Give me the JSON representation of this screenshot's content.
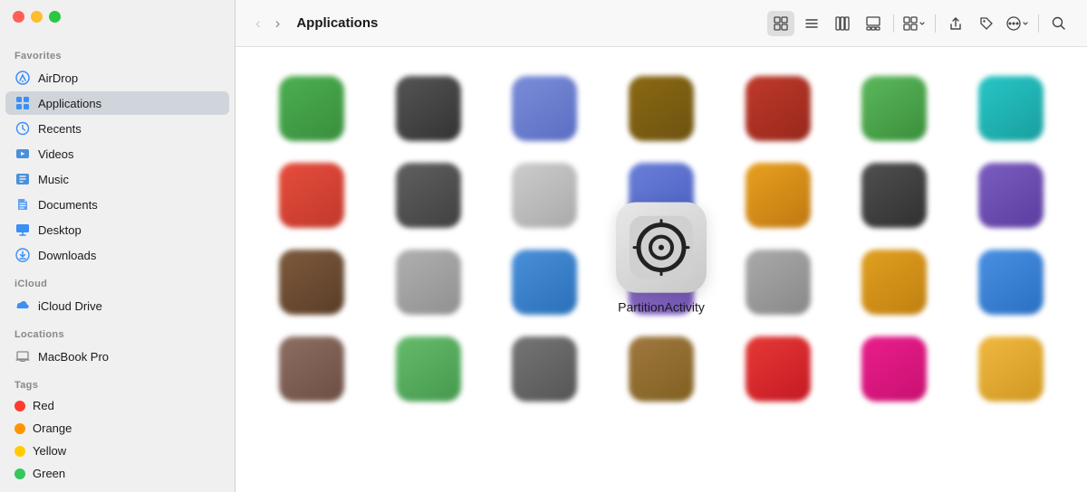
{
  "window": {
    "title": "Applications"
  },
  "traffic_lights": {
    "red_label": "close",
    "yellow_label": "minimize",
    "green_label": "maximize"
  },
  "toolbar": {
    "back_button": "‹",
    "forward_button": "›",
    "title": "Applications",
    "view_icons": [
      "grid-icon",
      "list-icon",
      "columns-icon",
      "gallery-icon",
      "groupby-icon",
      "share-icon",
      "tag-icon",
      "action-icon",
      "search-icon"
    ]
  },
  "sidebar": {
    "sections": [
      {
        "id": "favorites",
        "label": "Favorites",
        "items": [
          {
            "id": "airdrop",
            "label": "AirDrop",
            "icon_color": "#3b8ff5",
            "icon_type": "airdrop"
          },
          {
            "id": "applications",
            "label": "Applications",
            "icon_color": "#3b8ff5",
            "icon_type": "apps",
            "active": true
          },
          {
            "id": "recents",
            "label": "Recents",
            "icon_color": "#3b8ff5",
            "icon_type": "clock"
          },
          {
            "id": "videos",
            "label": "Videos",
            "icon_color": "#4a90d9",
            "icon_type": "folder"
          },
          {
            "id": "music",
            "label": "Music",
            "icon_color": "#4a90d9",
            "icon_type": "folder"
          },
          {
            "id": "documents",
            "label": "Documents",
            "icon_color": "#3b8ff5",
            "icon_type": "doc"
          },
          {
            "id": "desktop",
            "label": "Desktop",
            "icon_color": "#3b8ff5",
            "icon_type": "desktop"
          },
          {
            "id": "downloads",
            "label": "Downloads",
            "icon_color": "#3b8ff5",
            "icon_type": "download"
          }
        ]
      },
      {
        "id": "icloud",
        "label": "iCloud",
        "items": [
          {
            "id": "icloud-drive",
            "label": "iCloud Drive",
            "icon_color": "#3b8ff5",
            "icon_type": "cloud"
          }
        ]
      },
      {
        "id": "locations",
        "label": "Locations",
        "items": [
          {
            "id": "macbook-pro",
            "label": "MacBook Pro",
            "icon_color": "#888",
            "icon_type": "laptop"
          }
        ]
      },
      {
        "id": "tags",
        "label": "Tags",
        "items": [
          {
            "id": "tag-red",
            "label": "Red",
            "dot_color": "#ff3b30"
          },
          {
            "id": "tag-orange",
            "label": "Orange",
            "dot_color": "#ff9500"
          },
          {
            "id": "tag-yellow",
            "label": "Yellow",
            "dot_color": "#ffcc00"
          },
          {
            "id": "tag-green",
            "label": "Green",
            "dot_color": "#34c759"
          }
        ]
      }
    ]
  },
  "focused_app": {
    "name": "PartitionActivity",
    "icon_bg": "#e0e0e0"
  },
  "app_grid_rows": [
    [
      {
        "color": "#4caf50",
        "color2": "#388e3c"
      },
      {
        "color": "#555",
        "color2": "#333"
      },
      {
        "color": "#7b8dd8",
        "color2": "#5a6dc2"
      },
      {
        "color": "#8B6914",
        "color2": "#6d5310"
      },
      {
        "color": "#c0392b",
        "color2": "#96281b"
      },
      {
        "color": "#5cb85c",
        "color2": "#3a8f3a"
      },
      {
        "color": "#26c6c6",
        "color2": "#1a9e9e"
      }
    ],
    [
      {
        "color": "#e74c3c",
        "color2": "#c0392b"
      },
      {
        "color": "#606060",
        "color2": "#404040"
      },
      {
        "color": "#cccccc",
        "color2": "#aaaaaa",
        "focused": true
      },
      {
        "color": "#6a7fd8",
        "color2": "#4a5fc0"
      },
      {
        "color": "#e8a020",
        "color2": "#c07810"
      },
      {
        "color": "#505050",
        "color2": "#303030"
      },
      {
        "color": "#7c5cbf",
        "color2": "#5a3da0"
      }
    ],
    [
      {
        "color": "#7d5a3c",
        "color2": "#5a3d28"
      },
      {
        "color": "#b0b0b0",
        "color2": "#909090"
      },
      {
        "color": "#4a90d9",
        "color2": "#2a70b9"
      },
      {
        "color": "#9575cd",
        "color2": "#7355b5"
      },
      {
        "color": "#aaaaaa",
        "color2": "#888888"
      },
      {
        "color": "#e0a020",
        "color2": "#c08010"
      },
      {
        "color": "#4a90e2",
        "color2": "#2a70c2"
      }
    ],
    [
      {
        "color": "#8d6e63",
        "color2": "#6d4e43"
      },
      {
        "color": "#66bb6a",
        "color2": "#44994e"
      },
      {
        "color": "#757575",
        "color2": "#555555"
      },
      {
        "color": "#a07840",
        "color2": "#806020"
      },
      {
        "color": "#e53935",
        "color2": "#c51925"
      },
      {
        "color": "#e91e8c",
        "color2": "#c91070"
      },
      {
        "color": "#f0b840",
        "color2": "#d09820"
      }
    ]
  ]
}
